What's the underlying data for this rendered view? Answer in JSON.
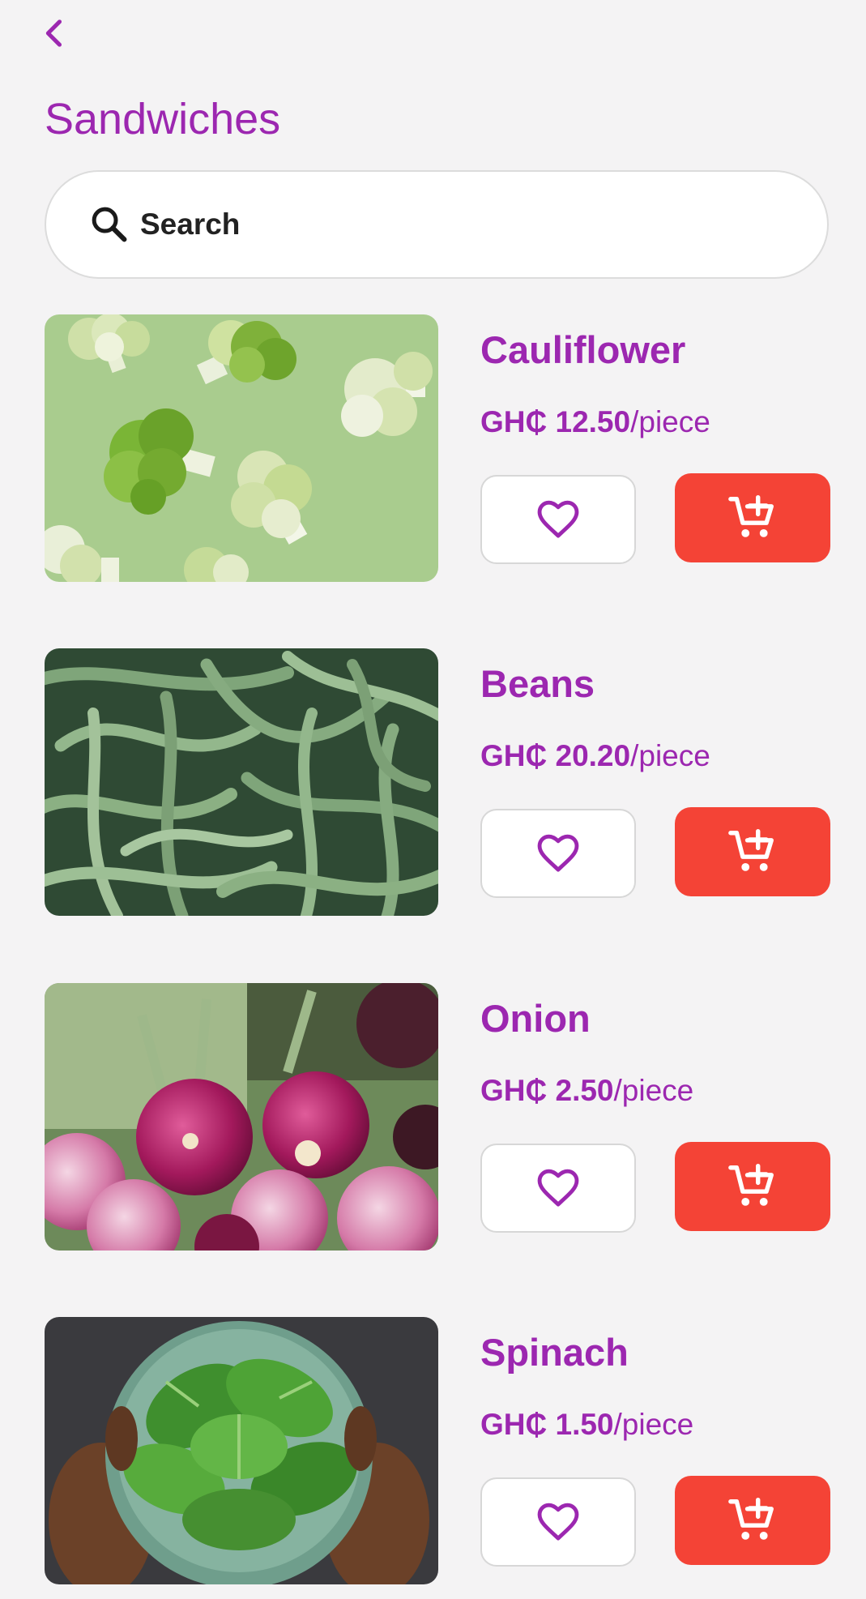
{
  "header": {
    "title": "Sandwiches",
    "back_icon": "chevron-left-icon"
  },
  "search": {
    "placeholder": "Search",
    "value": "",
    "icon": "search-icon"
  },
  "colors": {
    "accent": "#9c27b0",
    "cart_button": "#f44336",
    "background": "#f4f3f4"
  },
  "products": [
    {
      "name": "Cauliflower",
      "price": "GH₵ 12.50",
      "unit": "/piece",
      "image": "cauliflower-image"
    },
    {
      "name": "Beans",
      "price": "GH₵ 20.20",
      "unit": "/piece",
      "image": "beans-image"
    },
    {
      "name": "Onion",
      "price": "GH₵ 2.50",
      "unit": "/piece",
      "image": "onion-image"
    },
    {
      "name": "Spinach",
      "price": "GH₵ 1.50",
      "unit": "/piece",
      "image": "spinach-image"
    }
  ],
  "actions": {
    "favorite_icon": "heart-outline-icon",
    "cart_icon": "add-to-cart-icon"
  }
}
